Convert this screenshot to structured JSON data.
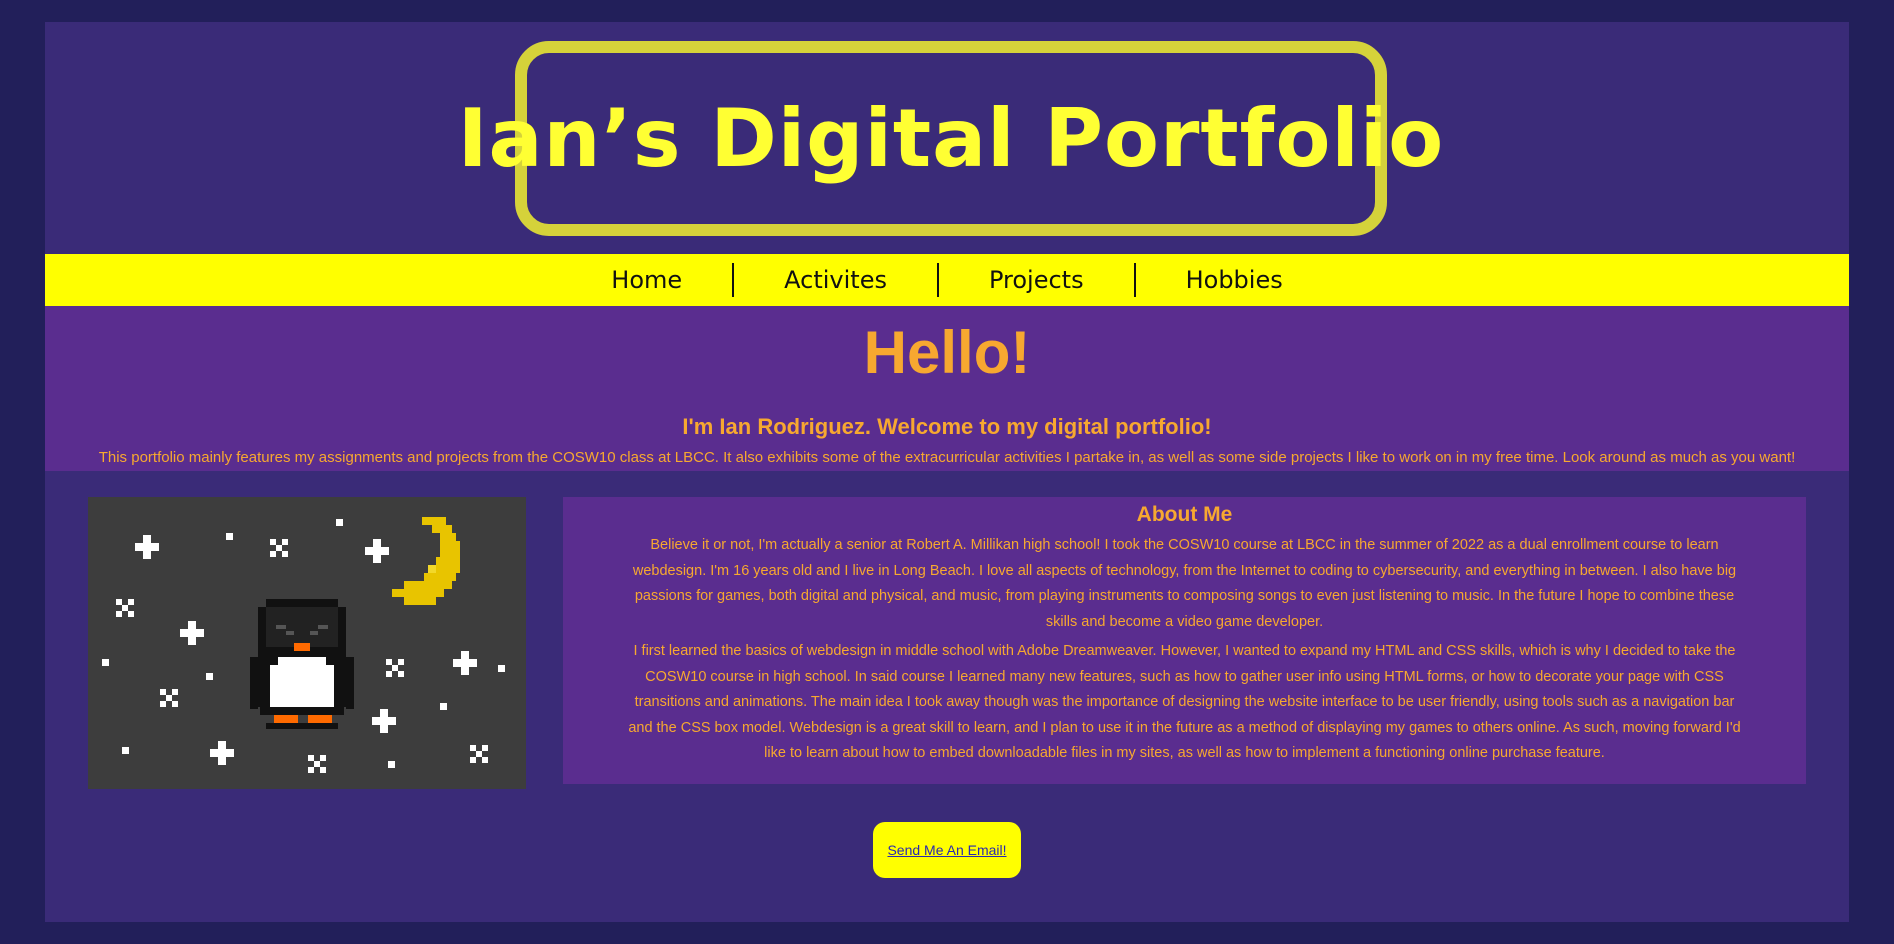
{
  "header": {
    "title": "Ian’s Digital Portfolio"
  },
  "nav": {
    "items": [
      "Home",
      "Activites",
      "Projects",
      "Hobbies"
    ]
  },
  "hero": {
    "heading": "Hello!",
    "subheading": "I'm Ian Rodriguez. Welcome to my digital portfolio!",
    "intro": "This portfolio mainly features my assignments and projects from the COSW10 class at LBCC. It also exhibits some of the extracurricular activities I partake in, as well as some side projects I like to work on in my free time. Look around as much as you want!"
  },
  "about": {
    "title": "About Me",
    "paragraph1": "Believe it or not, I'm actually a senior at Robert A. Millikan high school! I took the COSW10 course at LBCC in the summer of 2022 as a dual enrollment course to learn webdesign. I'm 16 years old and I live in Long Beach. I love all aspects of technology, from the Internet to coding to cybersecurity, and everything in between. I also have big passions for games, both digital and physical, and music, from playing instruments to composing songs to even just listening to music. In the future I hope to combine these skills and become a video game developer.",
    "paragraph2": "I first learned the basics of webdesign in middle school with Adobe Dreamweaver. However, I wanted to expand my HTML and CSS skills, which is why I decided to take the COSW10 course in high school. In said course I learned many new features, such as how to gather user info using HTML forms, or how to decorate your page with CSS transitions and animations. The main idea I took away though was the importance of designing the website interface to be user friendly, using tools such as a navigation bar and the CSS box model. Webdesign is a great skill to learn, and I plan to use it in the future as a method of displaying my games to others online. As such, moving forward I'd like to learn about how to embed downloadable files in my sites, as well as how to implement a functioning online purchase feature."
  },
  "contact": {
    "button_label": "Send Me An Email!"
  },
  "colors": {
    "background": "#221f5a",
    "page": "#3a2b78",
    "section": "#5a2d8f",
    "accent_yellow": "#ffff00",
    "text_orange": "#f7a830"
  },
  "image": {
    "subject": "pixel-art penguin under a crescent moon and stars"
  }
}
